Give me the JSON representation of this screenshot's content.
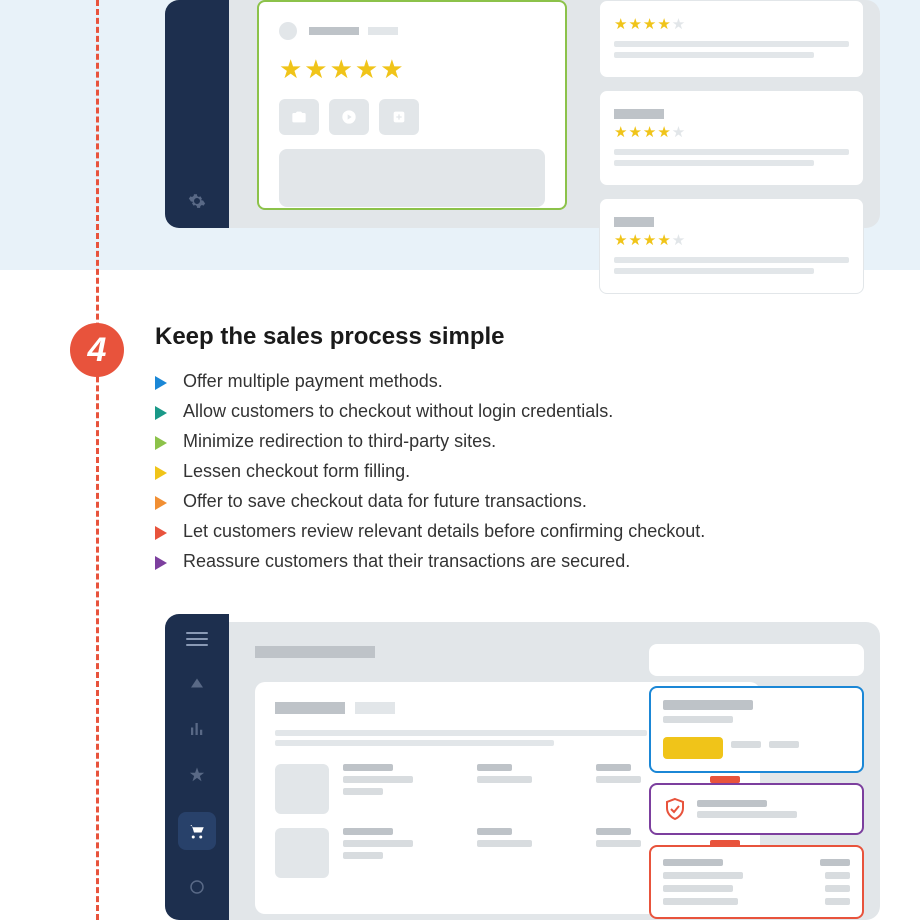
{
  "section": {
    "number": "4",
    "title": "Keep the sales process simple",
    "bullets": [
      {
        "color": "#1b87d6",
        "text": "Offer multiple payment methods."
      },
      {
        "color": "#1a9988",
        "text": "Allow customers to checkout without login credentials."
      },
      {
        "color": "#8cc24a",
        "text": "Minimize redirection to third-party sites."
      },
      {
        "color": "#f0c419",
        "text": "Lessen checkout form filling."
      },
      {
        "color": "#f18f33",
        "text": "Offer to save checkout data for future transactions."
      },
      {
        "color": "#e8533c",
        "text": "Let customers review relevant details before confirming checkout."
      },
      {
        "color": "#7c3f9e",
        "text": "Reassure customers that their transactions are secured."
      }
    ]
  }
}
